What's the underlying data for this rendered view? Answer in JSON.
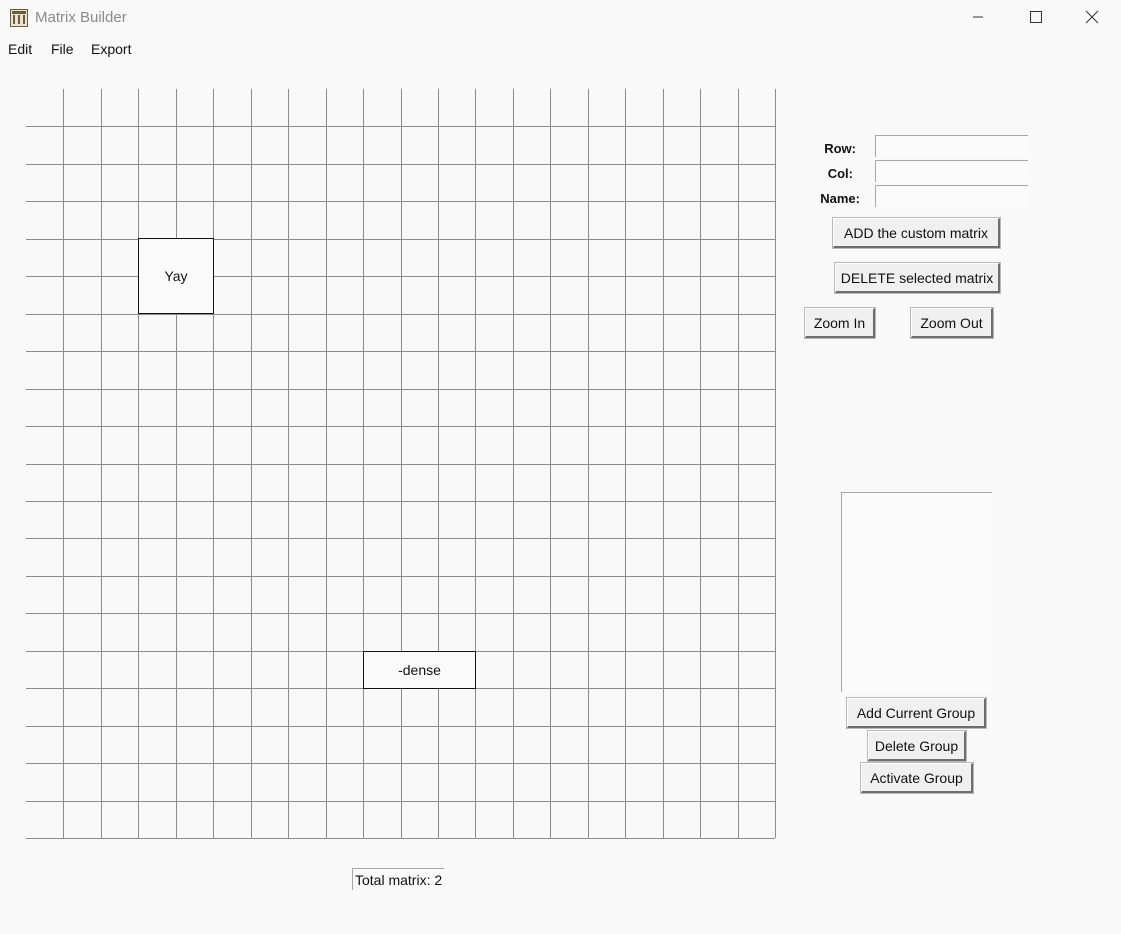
{
  "window": {
    "title": "Matrix Builder",
    "controls": {
      "minimize_icon": "minimize-icon",
      "maximize_icon": "maximize-icon",
      "close_icon": "close-icon"
    }
  },
  "menu": {
    "items": [
      "Edit",
      "File",
      "Export"
    ]
  },
  "canvas": {
    "grid_columns": 20,
    "grid_rows": 20,
    "matrices": [
      {
        "name": "Yay"
      },
      {
        "name": "-dense"
      }
    ]
  },
  "form": {
    "row_label": "Row:",
    "col_label": "Col:",
    "name_label": "Name:",
    "row_value": "",
    "col_value": "",
    "name_value": ""
  },
  "buttons": {
    "add_matrix": "ADD the custom matrix",
    "delete_matrix": "DELETE selected matrix",
    "zoom_in": "Zoom In",
    "zoom_out": "Zoom Out",
    "add_group": "Add Current Group",
    "delete_group": "Delete Group",
    "activate_group": "Activate Group"
  },
  "groups": {
    "items": []
  },
  "status": {
    "total_matrix": "Total matrix: 2"
  },
  "colors": {
    "background": "#f9f9f9",
    "grid_line": "#8c8c8c",
    "matrix_border": "#111111"
  }
}
